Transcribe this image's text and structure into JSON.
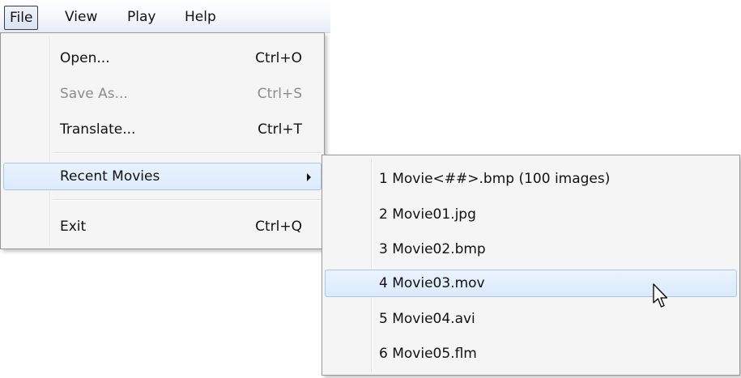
{
  "menubar": {
    "items": [
      {
        "label": "File"
      },
      {
        "label": "View"
      },
      {
        "label": "Play"
      },
      {
        "label": "Help"
      }
    ]
  },
  "file_menu": {
    "open": {
      "label": "Open...",
      "shortcut": "Ctrl+O"
    },
    "save_as": {
      "label": "Save As...",
      "shortcut": "Ctrl+S",
      "disabled": true
    },
    "translate": {
      "label": "Translate...",
      "shortcut": "Ctrl+T"
    },
    "recent_movies": {
      "label": "Recent Movies",
      "highlighted": true
    },
    "exit": {
      "label": "Exit",
      "shortcut": "Ctrl+Q"
    }
  },
  "recent_submenu": {
    "items": [
      {
        "label": "1 Movie<##>.bmp (100 images)"
      },
      {
        "label": "2 Movie01.jpg"
      },
      {
        "label": "3 Movie02.bmp"
      },
      {
        "label": "4 Movie03.mov",
        "highlighted": true
      },
      {
        "label": "5 Movie04.avi"
      },
      {
        "label": "6 Movie05.flm"
      }
    ]
  },
  "cursor": {
    "icon": "arrow-pointer-icon"
  },
  "colors": {
    "highlight_fill": "#dbeafc",
    "highlight_border": "#a8c8ec",
    "menu_bg": "#f5f5f5",
    "disabled_text": "#8d8d8d"
  }
}
